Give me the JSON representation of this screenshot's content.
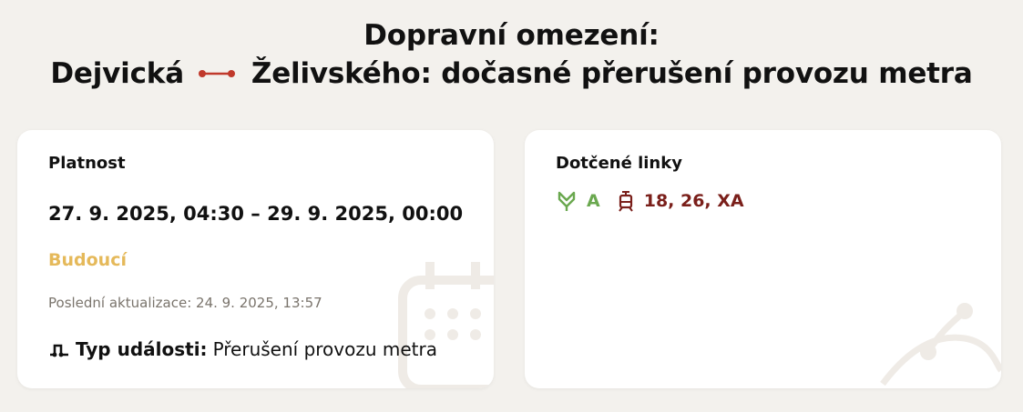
{
  "header": {
    "title_line1": "Dopravní omezení:",
    "from_station": "Dejvická",
    "to_station_text": "Želivského: dočasné přerušení provozu metra"
  },
  "validity_card": {
    "label": "Platnost",
    "date_range": "27. 9. 2025, 04:30 – 29. 9. 2025, 00:00",
    "status": "Budoucí",
    "last_update": "Poslední aktualizace: 24. 9. 2025, 13:57",
    "event_label": "Typ události:",
    "event_value": "Přerušení provozu metra"
  },
  "lines_card": {
    "label": "Dotčené linky",
    "metro_line": "A",
    "tram_lines": "18, 26, XA"
  },
  "colors": {
    "background": "#f3f1ed",
    "status": "#e5b95a",
    "metro": "#6aa84f",
    "tram": "#7a1f1a",
    "route_dot": "#c0392b"
  },
  "icons": {
    "route": "route-line-icon",
    "metro": "metro-icon",
    "tram": "tram-icon",
    "event": "interruption-icon",
    "calendar": "calendar-icon",
    "map": "map-icon"
  }
}
